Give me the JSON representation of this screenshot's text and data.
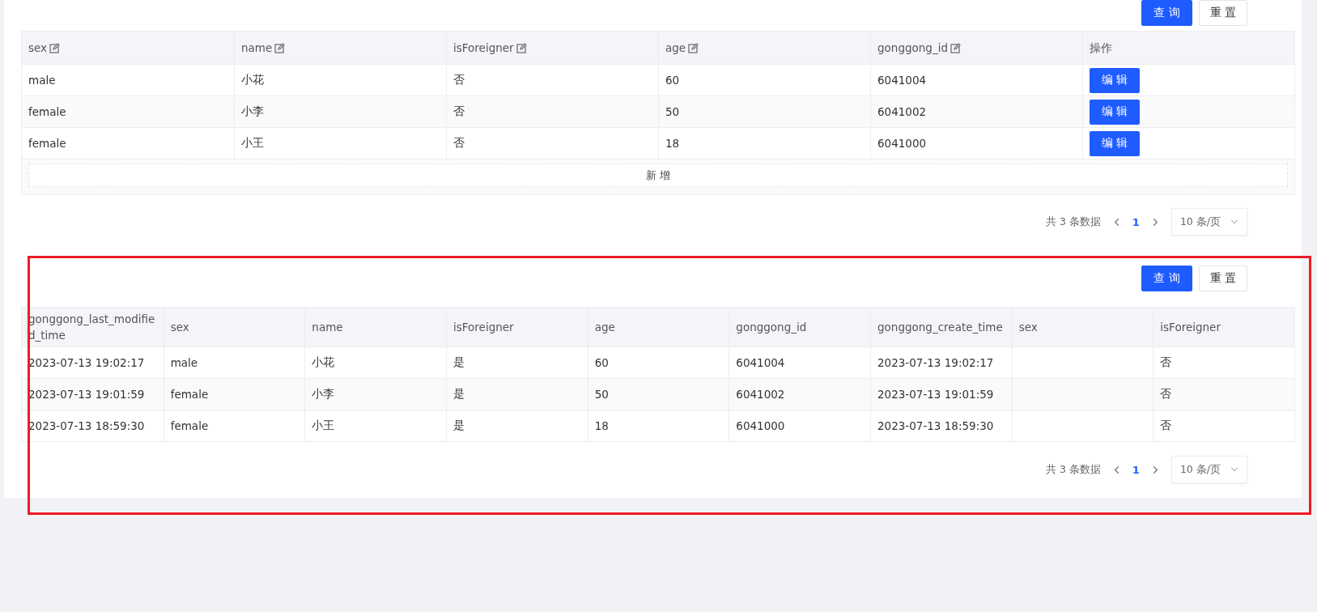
{
  "sections": [
    {
      "highlighted": false,
      "buttons": [
        {
          "label": "查 询",
          "kind": "primary"
        },
        {
          "label": "重 置",
          "kind": "default"
        }
      ],
      "columns": [
        {
          "label": "sex",
          "editable": true
        },
        {
          "label": "name",
          "editable": true
        },
        {
          "label": "isForeigner",
          "editable": true
        },
        {
          "label": "age",
          "editable": true
        },
        {
          "label": "gonggong_id",
          "editable": true
        },
        {
          "label": "操作",
          "editable": false
        }
      ],
      "rows": [
        {
          "cells": [
            "male",
            "小花",
            "否",
            "60",
            "6041004"
          ],
          "action": "编 辑"
        },
        {
          "cells": [
            "female",
            "小李",
            "否",
            "50",
            "6041002"
          ],
          "action": "编 辑"
        },
        {
          "cells": [
            "female",
            "小王",
            "否",
            "18",
            "6041000"
          ],
          "action": "编 辑"
        }
      ],
      "add_button": "新 增",
      "pagination": {
        "total": "共 3 条数据",
        "pages": [
          {
            "label": "1",
            "selected": true
          }
        ],
        "page_size": "10 条/页"
      }
    },
    {
      "highlighted": true,
      "buttons": [
        {
          "label": "查 询",
          "kind": "primary"
        },
        {
          "label": "重 置",
          "kind": "default"
        }
      ],
      "columns": [
        {
          "label": "gonggong_last_modified_time"
        },
        {
          "label": "sex"
        },
        {
          "label": "name"
        },
        {
          "label": "isForeigner"
        },
        {
          "label": "age"
        },
        {
          "label": "gonggong_id"
        },
        {
          "label": "gonggong_create_time"
        },
        {
          "label": "sex"
        },
        {
          "label": "isForeigner"
        }
      ],
      "rows": [
        {
          "cells": [
            "2023-07-13 19:02:17",
            "male",
            "小花",
            "是",
            "60",
            "6041004",
            "2023-07-13 19:02:17",
            "",
            "否"
          ]
        },
        {
          "cells": [
            "2023-07-13 19:01:59",
            "female",
            "小李",
            "是",
            "50",
            "6041002",
            "2023-07-13 19:01:59",
            "",
            "否"
          ]
        },
        {
          "cells": [
            "2023-07-13 18:59:30",
            "female",
            "小王",
            "是",
            "18",
            "6041000",
            "2023-07-13 18:59:30",
            "",
            "否"
          ]
        }
      ],
      "pagination": {
        "total": "共 3 条数据",
        "pages": [
          {
            "label": "1",
            "selected": true
          }
        ],
        "page_size": "10 条/页"
      }
    }
  ]
}
